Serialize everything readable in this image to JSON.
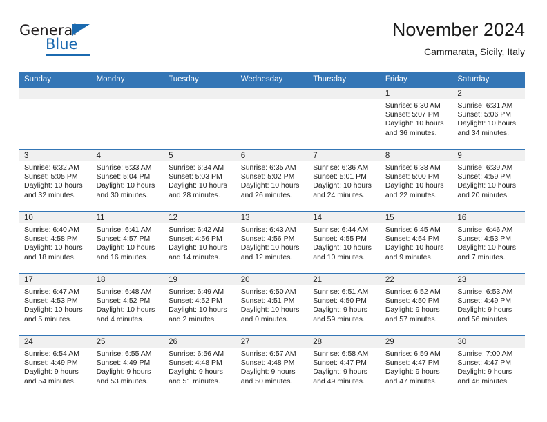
{
  "brand": {
    "name_part1": "General",
    "name_part2": "Blue"
  },
  "header": {
    "title": "November 2024",
    "subtitle": "Cammarata, Sicily, Italy"
  },
  "colors": {
    "header_blue": "#3476b6",
    "brand_blue": "#1b6ab0",
    "daynum_band": "#f0f0f0"
  },
  "weekday_headers": [
    "Sunday",
    "Monday",
    "Tuesday",
    "Wednesday",
    "Thursday",
    "Friday",
    "Saturday"
  ],
  "weeks": [
    [
      {
        "day": "",
        "sunrise": "",
        "sunset": "",
        "daylight": "",
        "empty": true
      },
      {
        "day": "",
        "sunrise": "",
        "sunset": "",
        "daylight": "",
        "empty": true
      },
      {
        "day": "",
        "sunrise": "",
        "sunset": "",
        "daylight": "",
        "empty": true
      },
      {
        "day": "",
        "sunrise": "",
        "sunset": "",
        "daylight": "",
        "empty": true
      },
      {
        "day": "",
        "sunrise": "",
        "sunset": "",
        "daylight": "",
        "empty": true
      },
      {
        "day": "1",
        "sunrise": "Sunrise: 6:30 AM",
        "sunset": "Sunset: 5:07 PM",
        "daylight": "Daylight: 10 hours and 36 minutes."
      },
      {
        "day": "2",
        "sunrise": "Sunrise: 6:31 AM",
        "sunset": "Sunset: 5:06 PM",
        "daylight": "Daylight: 10 hours and 34 minutes."
      }
    ],
    [
      {
        "day": "3",
        "sunrise": "Sunrise: 6:32 AM",
        "sunset": "Sunset: 5:05 PM",
        "daylight": "Daylight: 10 hours and 32 minutes."
      },
      {
        "day": "4",
        "sunrise": "Sunrise: 6:33 AM",
        "sunset": "Sunset: 5:04 PM",
        "daylight": "Daylight: 10 hours and 30 minutes."
      },
      {
        "day": "5",
        "sunrise": "Sunrise: 6:34 AM",
        "sunset": "Sunset: 5:03 PM",
        "daylight": "Daylight: 10 hours and 28 minutes."
      },
      {
        "day": "6",
        "sunrise": "Sunrise: 6:35 AM",
        "sunset": "Sunset: 5:02 PM",
        "daylight": "Daylight: 10 hours and 26 minutes."
      },
      {
        "day": "7",
        "sunrise": "Sunrise: 6:36 AM",
        "sunset": "Sunset: 5:01 PM",
        "daylight": "Daylight: 10 hours and 24 minutes."
      },
      {
        "day": "8",
        "sunrise": "Sunrise: 6:38 AM",
        "sunset": "Sunset: 5:00 PM",
        "daylight": "Daylight: 10 hours and 22 minutes."
      },
      {
        "day": "9",
        "sunrise": "Sunrise: 6:39 AM",
        "sunset": "Sunset: 4:59 PM",
        "daylight": "Daylight: 10 hours and 20 minutes."
      }
    ],
    [
      {
        "day": "10",
        "sunrise": "Sunrise: 6:40 AM",
        "sunset": "Sunset: 4:58 PM",
        "daylight": "Daylight: 10 hours and 18 minutes."
      },
      {
        "day": "11",
        "sunrise": "Sunrise: 6:41 AM",
        "sunset": "Sunset: 4:57 PM",
        "daylight": "Daylight: 10 hours and 16 minutes."
      },
      {
        "day": "12",
        "sunrise": "Sunrise: 6:42 AM",
        "sunset": "Sunset: 4:56 PM",
        "daylight": "Daylight: 10 hours and 14 minutes."
      },
      {
        "day": "13",
        "sunrise": "Sunrise: 6:43 AM",
        "sunset": "Sunset: 4:56 PM",
        "daylight": "Daylight: 10 hours and 12 minutes."
      },
      {
        "day": "14",
        "sunrise": "Sunrise: 6:44 AM",
        "sunset": "Sunset: 4:55 PM",
        "daylight": "Daylight: 10 hours and 10 minutes."
      },
      {
        "day": "15",
        "sunrise": "Sunrise: 6:45 AM",
        "sunset": "Sunset: 4:54 PM",
        "daylight": "Daylight: 10 hours and 9 minutes."
      },
      {
        "day": "16",
        "sunrise": "Sunrise: 6:46 AM",
        "sunset": "Sunset: 4:53 PM",
        "daylight": "Daylight: 10 hours and 7 minutes."
      }
    ],
    [
      {
        "day": "17",
        "sunrise": "Sunrise: 6:47 AM",
        "sunset": "Sunset: 4:53 PM",
        "daylight": "Daylight: 10 hours and 5 minutes."
      },
      {
        "day": "18",
        "sunrise": "Sunrise: 6:48 AM",
        "sunset": "Sunset: 4:52 PM",
        "daylight": "Daylight: 10 hours and 4 minutes."
      },
      {
        "day": "19",
        "sunrise": "Sunrise: 6:49 AM",
        "sunset": "Sunset: 4:52 PM",
        "daylight": "Daylight: 10 hours and 2 minutes."
      },
      {
        "day": "20",
        "sunrise": "Sunrise: 6:50 AM",
        "sunset": "Sunset: 4:51 PM",
        "daylight": "Daylight: 10 hours and 0 minutes."
      },
      {
        "day": "21",
        "sunrise": "Sunrise: 6:51 AM",
        "sunset": "Sunset: 4:50 PM",
        "daylight": "Daylight: 9 hours and 59 minutes."
      },
      {
        "day": "22",
        "sunrise": "Sunrise: 6:52 AM",
        "sunset": "Sunset: 4:50 PM",
        "daylight": "Daylight: 9 hours and 57 minutes."
      },
      {
        "day": "23",
        "sunrise": "Sunrise: 6:53 AM",
        "sunset": "Sunset: 4:49 PM",
        "daylight": "Daylight: 9 hours and 56 minutes."
      }
    ],
    [
      {
        "day": "24",
        "sunrise": "Sunrise: 6:54 AM",
        "sunset": "Sunset: 4:49 PM",
        "daylight": "Daylight: 9 hours and 54 minutes."
      },
      {
        "day": "25",
        "sunrise": "Sunrise: 6:55 AM",
        "sunset": "Sunset: 4:49 PM",
        "daylight": "Daylight: 9 hours and 53 minutes."
      },
      {
        "day": "26",
        "sunrise": "Sunrise: 6:56 AM",
        "sunset": "Sunset: 4:48 PM",
        "daylight": "Daylight: 9 hours and 51 minutes."
      },
      {
        "day": "27",
        "sunrise": "Sunrise: 6:57 AM",
        "sunset": "Sunset: 4:48 PM",
        "daylight": "Daylight: 9 hours and 50 minutes."
      },
      {
        "day": "28",
        "sunrise": "Sunrise: 6:58 AM",
        "sunset": "Sunset: 4:47 PM",
        "daylight": "Daylight: 9 hours and 49 minutes."
      },
      {
        "day": "29",
        "sunrise": "Sunrise: 6:59 AM",
        "sunset": "Sunset: 4:47 PM",
        "daylight": "Daylight: 9 hours and 47 minutes."
      },
      {
        "day": "30",
        "sunrise": "Sunrise: 7:00 AM",
        "sunset": "Sunset: 4:47 PM",
        "daylight": "Daylight: 9 hours and 46 minutes."
      }
    ]
  ]
}
